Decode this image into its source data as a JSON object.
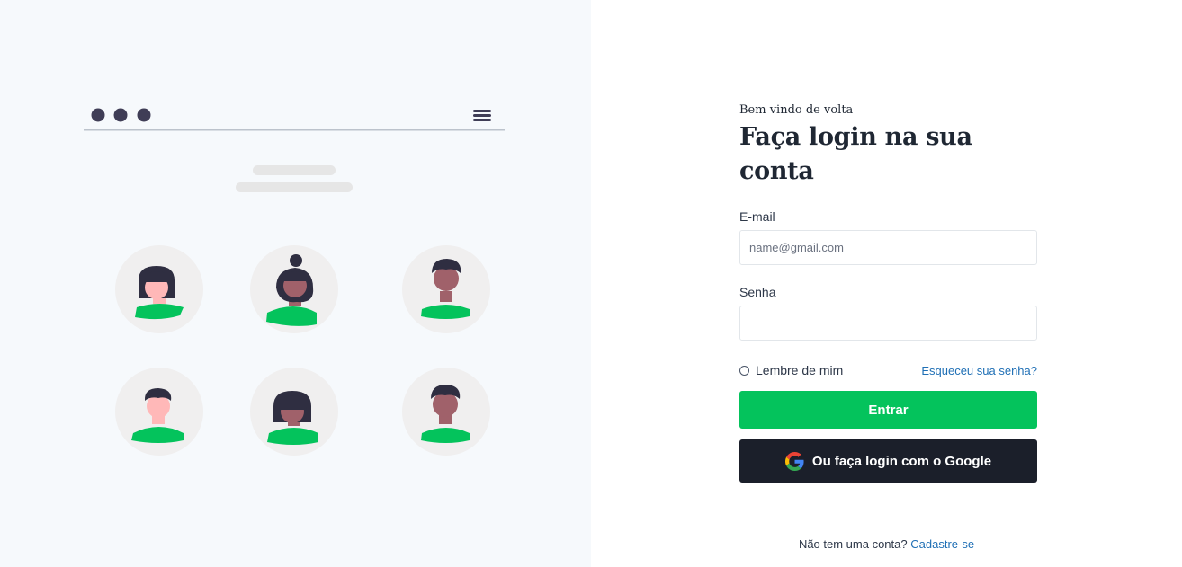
{
  "login": {
    "welcome": "Bem vindo de volta",
    "title": "Faça login na sua conta",
    "email_label": "E-mail",
    "email_placeholder": "name@gmail.com",
    "email_value": "",
    "password_label": "Senha",
    "password_value": "",
    "remember_label": "Lembre de mim",
    "forgot_label": "Esqueceu sua senha?",
    "submit_label": "Entrar",
    "google_label": "Ou faça login com o Google",
    "no_account_text": "Não tem uma conta?",
    "signup_label": "Cadastre-se"
  },
  "colors": {
    "primary_green": "#04c35c",
    "dark_button": "#1b1f2a",
    "link_blue": "#1f6fb5",
    "left_background": "#f6f9fc"
  },
  "icons": {
    "google": "google-g-icon",
    "menu": "hamburger-menu-icon",
    "window_dots": "window-dots-icon"
  }
}
